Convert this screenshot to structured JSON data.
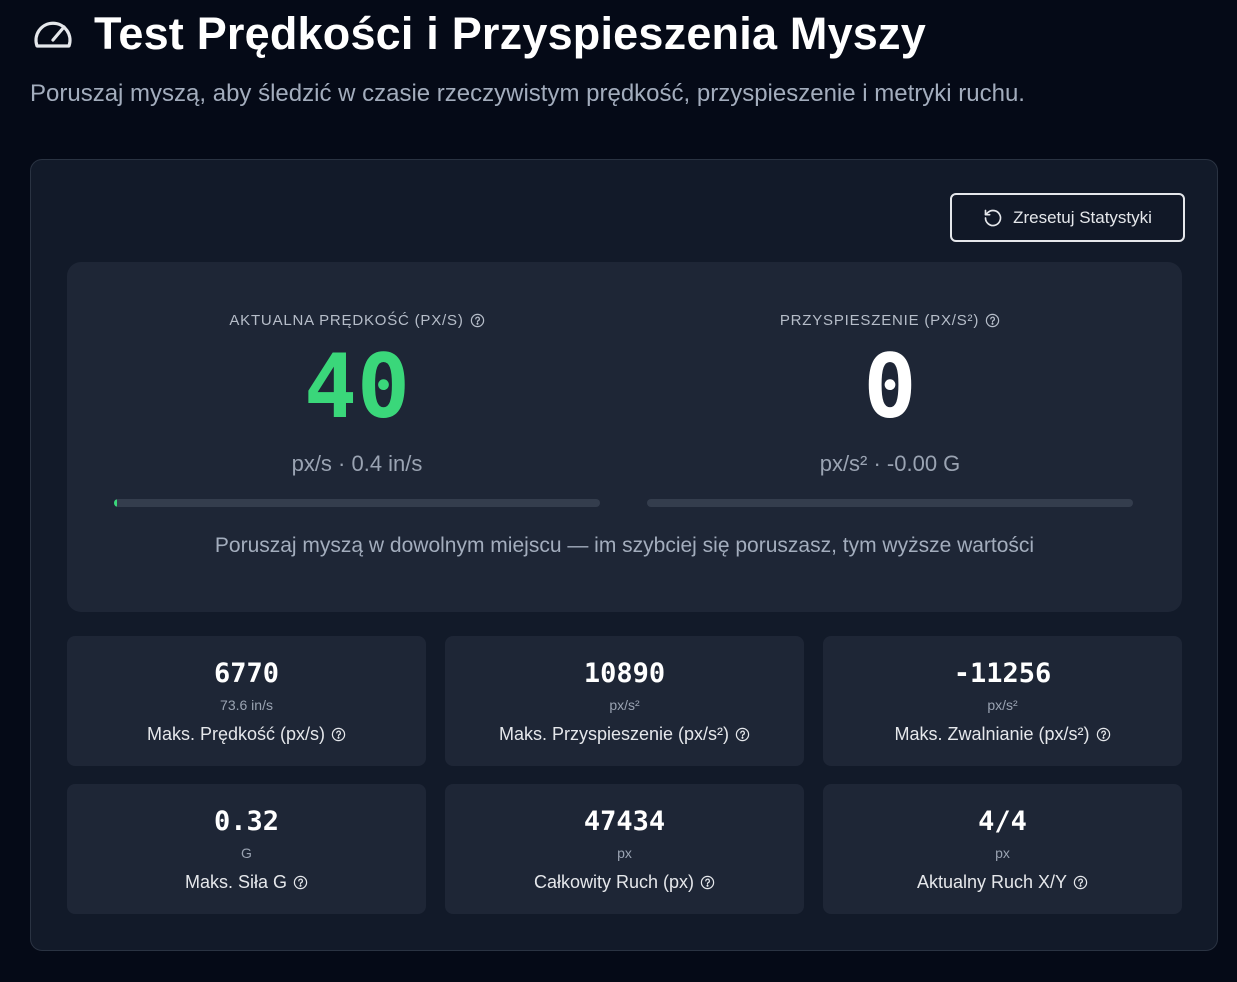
{
  "header": {
    "title": "Test Prędkości i Przyspieszenia Myszy",
    "subtitle": "Poruszaj myszą, aby śledzić w czasie rzeczywistym prędkość, przyspieszenie i metryki ruchu.",
    "icon": "speedometer-icon"
  },
  "toolbar": {
    "reset_label": "Zresetuj Statystyki",
    "reset_icon": "rotate-ccw-icon"
  },
  "live": {
    "speed": {
      "label": "AKTUALNA PRĘDKOŚĆ (PX/S)",
      "value": "40",
      "units": "px/s · 0.4 in/s",
      "progress_fraction": 0.006
    },
    "acceleration": {
      "label": "PRZYSPIESZENIE (PX/S²)",
      "value": "0",
      "units": "px/s² · -0.00 G",
      "progress_fraction": 0
    },
    "hint": "Poruszaj myszą w dowolnym miejscu — im szybciej się poruszasz, tym wyższe wartości"
  },
  "stats": [
    {
      "value": "6770",
      "unit": "73.6 in/s",
      "label": "Maks. Prędkość (px/s)"
    },
    {
      "value": "10890",
      "unit": "px/s²",
      "label": "Maks. Przyspieszenie (px/s²)"
    },
    {
      "value": "-11256",
      "unit": "px/s²",
      "label": "Maks. Zwalnianie (px/s²)"
    },
    {
      "value": "0.32",
      "unit": "G",
      "label": "Maks. Siła G"
    },
    {
      "value": "47434",
      "unit": "px",
      "label": "Całkowity Ruch (px)"
    },
    {
      "value": "4/4",
      "unit": "px",
      "label": "Aktualny Ruch X/Y"
    }
  ],
  "colors": {
    "accent_green": "#3ad77a",
    "background": "#050a17",
    "card": "#1e2636"
  }
}
